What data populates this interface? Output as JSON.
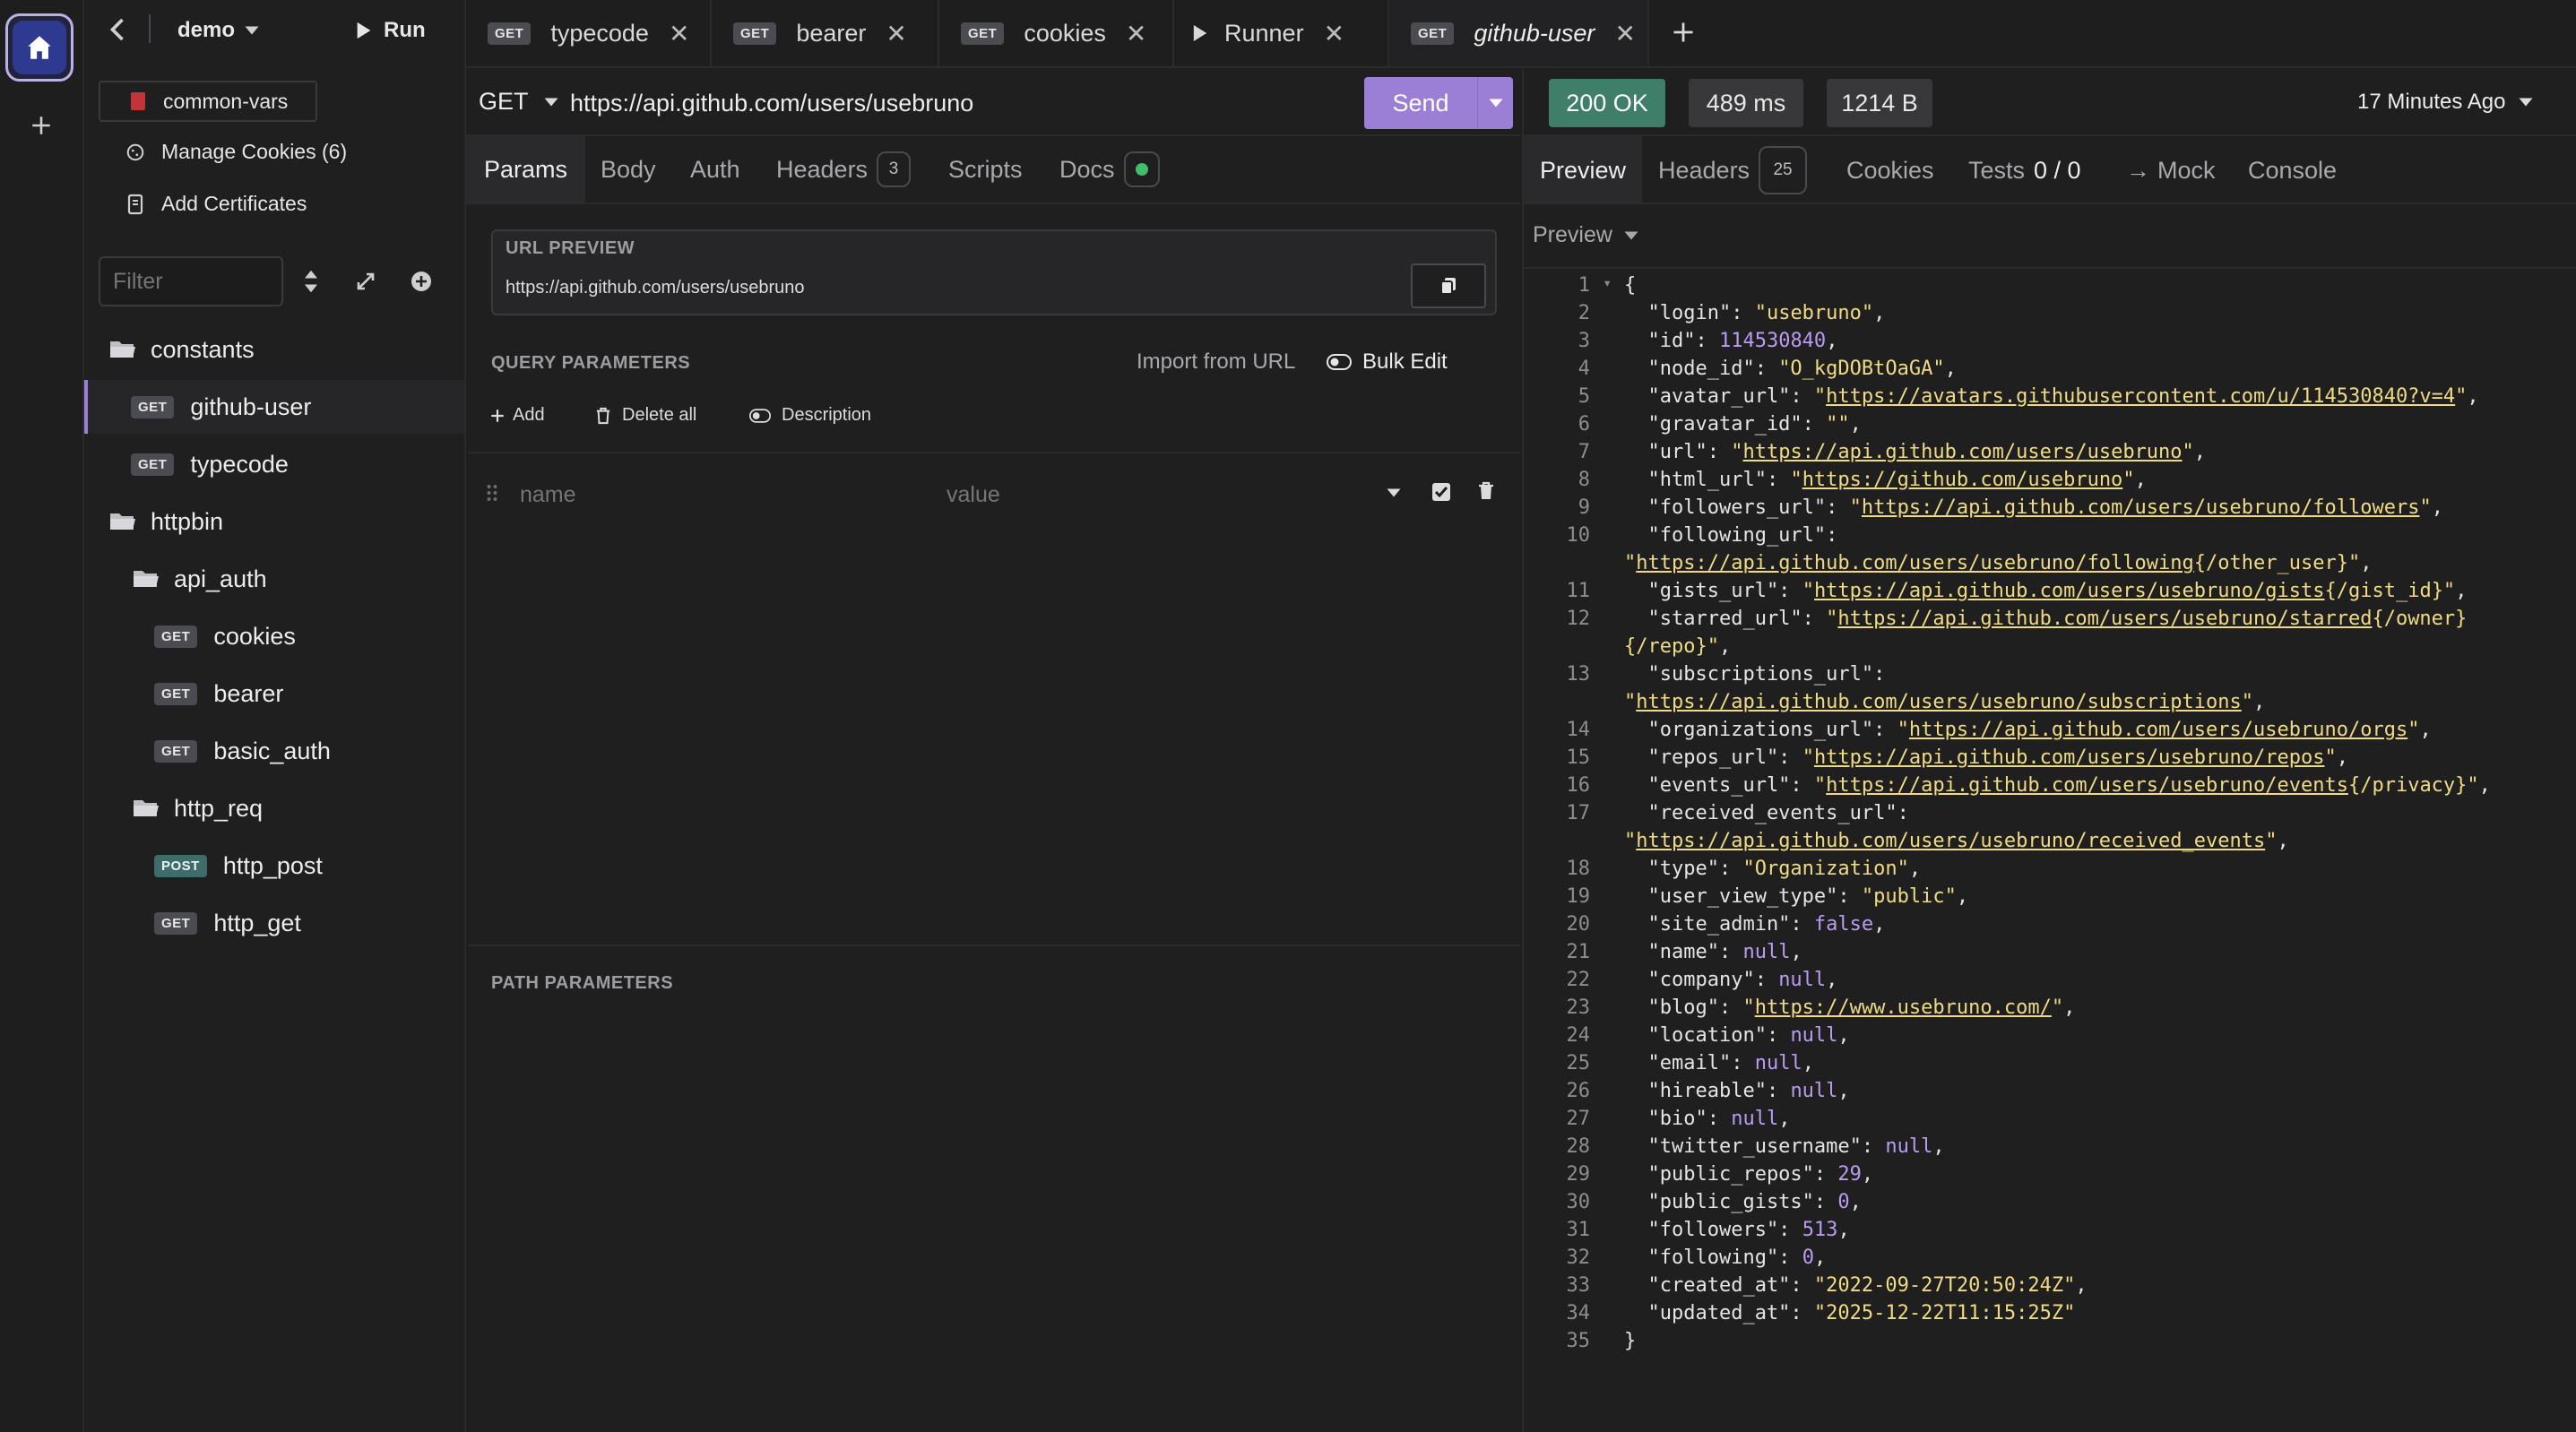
{
  "sidebar": {
    "collection_name": "demo",
    "run_label": "Run",
    "links": [
      {
        "label": "common-vars"
      },
      {
        "label": "Manage Cookies (6)"
      },
      {
        "label": "Add Certificates"
      }
    ],
    "filter_placeholder": "Filter",
    "tree": [
      {
        "type": "folder",
        "label": "constants"
      },
      {
        "type": "request",
        "method": "GET",
        "label": "github-user",
        "selected": true
      },
      {
        "type": "request",
        "method": "GET",
        "label": "typecode"
      },
      {
        "type": "folder",
        "label": "httpbin"
      },
      {
        "type": "folder",
        "label": "api_auth"
      },
      {
        "type": "request",
        "method": "GET",
        "label": "cookies"
      },
      {
        "type": "request",
        "method": "GET",
        "label": "bearer"
      },
      {
        "type": "request",
        "method": "GET",
        "label": "basic_auth"
      },
      {
        "type": "folder",
        "label": "http_req"
      },
      {
        "type": "request",
        "method": "POST",
        "label": "http_post"
      },
      {
        "type": "request",
        "method": "GET",
        "label": "http_get"
      }
    ]
  },
  "tabs": [
    {
      "method": "GET",
      "label": "typecode"
    },
    {
      "method": "GET",
      "label": "bearer"
    },
    {
      "method": "GET",
      "label": "cookies"
    },
    {
      "method": "",
      "label": "Runner"
    },
    {
      "method": "GET",
      "label": "github-user",
      "active": true
    }
  ],
  "request": {
    "method": "GET",
    "url": "https://api.github.com/users/usebruno",
    "send_label": "Send",
    "tabs": [
      {
        "label": "Params",
        "active": true
      },
      {
        "label": "Body"
      },
      {
        "label": "Auth"
      },
      {
        "label": "Headers",
        "count": "3"
      },
      {
        "label": "Scripts"
      },
      {
        "label": "Docs"
      }
    ],
    "url_preview_title": "URL PREVIEW",
    "url_preview": "https://api.github.com/users/usebruno",
    "query_title": "QUERY PARAMETERS",
    "import_label": "Import from URL",
    "bulk_edit_label": "Bulk Edit",
    "add_label": "Add",
    "delete_all_label": "Delete all",
    "description_label": "Description",
    "name_placeholder": "name",
    "value_placeholder": "value",
    "path_title": "PATH PARAMETERS"
  },
  "response": {
    "status": "200 OK",
    "time": "489 ms",
    "size": "1214 B",
    "ago": "17 Minutes Ago",
    "tabs": [
      {
        "label": "Preview",
        "active": true
      },
      {
        "label": "Headers",
        "count": "25"
      },
      {
        "label": "Cookies"
      },
      {
        "label": "Tests",
        "extra": "0 / 0"
      },
      {
        "label": "Mock"
      },
      {
        "label": "Console"
      }
    ],
    "preview_mode": "Preview",
    "lines": [
      [
        [
          "p",
          "{"
        ]
      ],
      [
        [
          "k",
          "  \"login\": "
        ],
        [
          "s",
          "\"usebruno\""
        ],
        [
          "p",
          ","
        ]
      ],
      [
        [
          "k",
          "  \"id\": "
        ],
        [
          "n",
          "114530840"
        ],
        [
          "p",
          ","
        ]
      ],
      [
        [
          "k",
          "  \"node_id\": "
        ],
        [
          "s",
          "\"O_kgDOBtOaGA\""
        ],
        [
          "p",
          ","
        ]
      ],
      [
        [
          "k",
          "  \"avatar_url\": "
        ],
        [
          "s",
          "\""
        ],
        [
          "u",
          "https://avatars.githubusercontent.com/u/114530840?v=4"
        ],
        [
          "s",
          "\""
        ],
        [
          "p",
          ","
        ]
      ],
      [
        [
          "k",
          "  \"gravatar_id\": "
        ],
        [
          "s",
          "\"\""
        ],
        [
          "p",
          ","
        ]
      ],
      [
        [
          "k",
          "  \"url\": "
        ],
        [
          "s",
          "\""
        ],
        [
          "u",
          "https://api.github.com/users/usebruno"
        ],
        [
          "s",
          "\""
        ],
        [
          "p",
          ","
        ]
      ],
      [
        [
          "k",
          "  \"html_url\": "
        ],
        [
          "s",
          "\""
        ],
        [
          "u",
          "https://github.com/usebruno"
        ],
        [
          "s",
          "\""
        ],
        [
          "p",
          ","
        ]
      ],
      [
        [
          "k",
          "  \"followers_url\": "
        ],
        [
          "s",
          "\""
        ],
        [
          "u",
          "https://api.github.com/users/usebruno/followers"
        ],
        [
          "s",
          "\""
        ],
        [
          "p",
          ","
        ]
      ],
      [
        [
          "k",
          "  \"following_url\":"
        ]
      ],
      [
        [
          "s",
          "\""
        ],
        [
          "u",
          "https://api.github.com/users/usebruno/following"
        ],
        [
          "s",
          "{/other_user}\""
        ],
        [
          "p",
          ","
        ]
      ],
      [
        [
          "k",
          "  \"gists_url\": "
        ],
        [
          "s",
          "\""
        ],
        [
          "u",
          "https://api.github.com/users/usebruno/gists"
        ],
        [
          "s",
          "{/gist_id}\""
        ],
        [
          "p",
          ","
        ]
      ],
      [
        [
          "k",
          "  \"starred_url\": "
        ],
        [
          "s",
          "\""
        ],
        [
          "u",
          "https://api.github.com/users/usebruno/starred"
        ],
        [
          "s",
          "{/owner}"
        ]
      ],
      [
        [
          "s",
          "{/repo}\""
        ],
        [
          "p",
          ","
        ]
      ],
      [
        [
          "k",
          "  \"subscriptions_url\":"
        ]
      ],
      [
        [
          "s",
          "\""
        ],
        [
          "u",
          "https://api.github.com/users/usebruno/subscriptions"
        ],
        [
          "s",
          "\""
        ],
        [
          "p",
          ","
        ]
      ],
      [
        [
          "k",
          "  \"organizations_url\": "
        ],
        [
          "s",
          "\""
        ],
        [
          "u",
          "https://api.github.com/users/usebruno/orgs"
        ],
        [
          "s",
          "\""
        ],
        [
          "p",
          ","
        ]
      ],
      [
        [
          "k",
          "  \"repos_url\": "
        ],
        [
          "s",
          "\""
        ],
        [
          "u",
          "https://api.github.com/users/usebruno/repos"
        ],
        [
          "s",
          "\""
        ],
        [
          "p",
          ","
        ]
      ],
      [
        [
          "k",
          "  \"events_url\": "
        ],
        [
          "s",
          "\""
        ],
        [
          "u",
          "https://api.github.com/users/usebruno/events"
        ],
        [
          "s",
          "{/privacy}\""
        ],
        [
          "p",
          ","
        ]
      ],
      [
        [
          "k",
          "  \"received_events_url\":"
        ]
      ],
      [
        [
          "s",
          "\""
        ],
        [
          "u",
          "https://api.github.com/users/usebruno/received_events"
        ],
        [
          "s",
          "\""
        ],
        [
          "p",
          ","
        ]
      ],
      [
        [
          "k",
          "  \"type\": "
        ],
        [
          "s",
          "\"Organization\""
        ],
        [
          "p",
          ","
        ]
      ],
      [
        [
          "k",
          "  \"user_view_type\": "
        ],
        [
          "s",
          "\"public\""
        ],
        [
          "p",
          ","
        ]
      ],
      [
        [
          "k",
          "  \"site_admin\": "
        ],
        [
          "n",
          "false"
        ],
        [
          "p",
          ","
        ]
      ],
      [
        [
          "k",
          "  \"name\": "
        ],
        [
          "n",
          "null"
        ],
        [
          "p",
          ","
        ]
      ],
      [
        [
          "k",
          "  \"company\": "
        ],
        [
          "n",
          "null"
        ],
        [
          "p",
          ","
        ]
      ],
      [
        [
          "k",
          "  \"blog\": "
        ],
        [
          "s",
          "\""
        ],
        [
          "u",
          "https://www.usebruno.com/"
        ],
        [
          "s",
          "\""
        ],
        [
          "p",
          ","
        ]
      ],
      [
        [
          "k",
          "  \"location\": "
        ],
        [
          "n",
          "null"
        ],
        [
          "p",
          ","
        ]
      ],
      [
        [
          "k",
          "  \"email\": "
        ],
        [
          "n",
          "null"
        ],
        [
          "p",
          ","
        ]
      ],
      [
        [
          "k",
          "  \"hireable\": "
        ],
        [
          "n",
          "null"
        ],
        [
          "p",
          ","
        ]
      ],
      [
        [
          "k",
          "  \"bio\": "
        ],
        [
          "n",
          "null"
        ],
        [
          "p",
          ","
        ]
      ],
      [
        [
          "k",
          "  \"twitter_username\": "
        ],
        [
          "n",
          "null"
        ],
        [
          "p",
          ","
        ]
      ],
      [
        [
          "k",
          "  \"public_repos\": "
        ],
        [
          "n",
          "29"
        ],
        [
          "p",
          ","
        ]
      ],
      [
        [
          "k",
          "  \"public_gists\": "
        ],
        [
          "n",
          "0"
        ],
        [
          "p",
          ","
        ]
      ],
      [
        [
          "k",
          "  \"followers\": "
        ],
        [
          "n",
          "513"
        ],
        [
          "p",
          ","
        ]
      ],
      [
        [
          "k",
          "  \"following\": "
        ],
        [
          "n",
          "0"
        ],
        [
          "p",
          ","
        ]
      ],
      [
        [
          "k",
          "  \"created_at\": "
        ],
        [
          "s",
          "\"2022-09-27T20:50:24Z\""
        ],
        [
          "p",
          ","
        ]
      ],
      [
        [
          "k",
          "  \"updated_at\": "
        ],
        [
          "s",
          "\"2025-12-22T11:15:25Z\""
        ]
      ],
      [
        [
          "p",
          "}"
        ]
      ]
    ],
    "line_numbers": [
      "1",
      "2",
      "3",
      "4",
      "5",
      "6",
      "7",
      "8",
      "9",
      "10",
      "",
      "11",
      "12",
      "",
      "13",
      "",
      "14",
      "15",
      "16",
      "17",
      "",
      "18",
      "19",
      "20",
      "21",
      "22",
      "23",
      "24",
      "25",
      "26",
      "27",
      "28",
      "29",
      "30",
      "31",
      "32",
      "33",
      "34",
      "35"
    ]
  },
  "colors": {
    "accent": "#9b7fd6",
    "status_ok": "#4a9e7c",
    "string": "#f0db83",
    "number": "#b99cf0"
  }
}
